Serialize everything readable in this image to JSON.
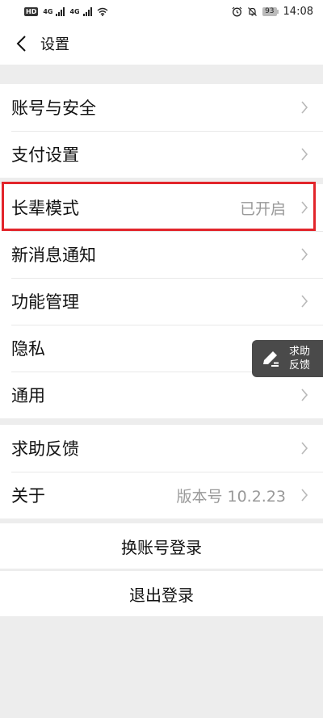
{
  "status_bar": {
    "hd_badge": "HD",
    "network_1": "4G",
    "network_2": "4G",
    "battery": "93",
    "time": "14:08"
  },
  "header": {
    "title": "设置"
  },
  "group1": [
    {
      "label": "账号与安全",
      "value": ""
    },
    {
      "label": "支付设置",
      "value": ""
    }
  ],
  "group2": [
    {
      "label": "长辈模式",
      "value": "已开启"
    },
    {
      "label": "新消息通知",
      "value": ""
    },
    {
      "label": "功能管理",
      "value": ""
    },
    {
      "label": "隐私",
      "value": ""
    },
    {
      "label": "通用",
      "value": ""
    }
  ],
  "group3": [
    {
      "label": "求助反馈",
      "value": ""
    },
    {
      "label": "关于",
      "value": "版本号 10.2.23"
    }
  ],
  "actions": {
    "switch_account": "换账号登录",
    "logout": "退出登录"
  },
  "floating_help": {
    "line1": "求助",
    "line2": "反馈"
  },
  "colors": {
    "highlight": "#e2252b",
    "background": "#ededed",
    "secondary_text": "#999999"
  }
}
